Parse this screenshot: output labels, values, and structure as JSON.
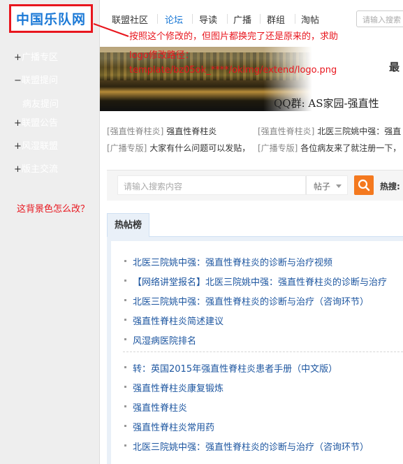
{
  "logo": {
    "text": "中国乐队网"
  },
  "sidebar": {
    "items": [
      {
        "sign": "+",
        "label": "广播专区"
      },
      {
        "sign": "−",
        "label": "联盟提问"
      },
      {
        "sign": "",
        "label": "病友提问"
      },
      {
        "sign": "+",
        "label": "联盟公告"
      },
      {
        "sign": "+",
        "label": "风湿联盟"
      },
      {
        "sign": "+",
        "label": "版主交流"
      }
    ],
    "note": "这背景色怎么改？"
  },
  "nav": {
    "items": [
      "联盟社区",
      "论坛",
      "导读",
      "广播",
      "群组",
      "淘帖"
    ],
    "active": "论坛",
    "search_placeholder": "请输入搜索"
  },
  "annotations": {
    "line1": "按照这个修改的，但图片都换完了还是原来的，求助",
    "line2": "logo修改路径：",
    "line3": "template/bz05ok_****/okimg/extend/logo.png"
  },
  "banner": {
    "qq_text": "QQ群: AS家园-强直性",
    "right_char": "最"
  },
  "info": {
    "row1": [
      {
        "tag": "[强直性脊柱炎]",
        "text": "强直性脊柱炎"
      },
      {
        "tag": "[强直性脊柱炎]",
        "text": "北医三院姚中强：强直"
      }
    ],
    "row2": [
      {
        "tag": "[广播专版]",
        "text": "大家有什么问题可以发贴，"
      },
      {
        "tag": "[广播专版]",
        "text": "各位病友来了就注册一下，"
      }
    ]
  },
  "forum_search": {
    "placeholder": "请输入搜索内容",
    "select_value": "帖子",
    "hot_label": "热搜:"
  },
  "hot_tab": {
    "label": "热帖榜"
  },
  "hot_list": [
    "北医三院姚中强：强直性脊柱炎的诊断与治疗视频",
    "【网络讲堂报名】北医三院姚中强：强直性脊柱炎的诊断与治疗",
    "北医三院姚中强：强直性脊柱炎的诊断与治疗（咨询环节）",
    "强直性脊柱炎简述建议",
    "风湿病医院排名",
    "转：英国2015年强直性脊柱炎患者手册（中文版）",
    "强直性脊柱炎康复锻炼",
    "强直性脊柱炎",
    "强直性脊柱炎常用药",
    "北医三院姚中强：强直性脊柱炎的诊断与治疗（咨询环节）"
  ],
  "colors": {
    "accent_blue": "#1b79d6",
    "annotation_red": "#e8161e",
    "search_orange": "#f4791f",
    "link_blue": "#1d56a0",
    "sidebar_bg": "#eeeeee"
  }
}
